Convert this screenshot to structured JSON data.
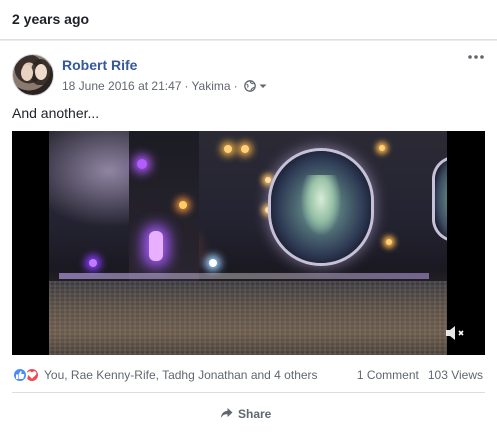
{
  "memory": {
    "title": "2 years ago"
  },
  "post": {
    "author": "Robert Rife",
    "date": "18 June 2016 at 21:47",
    "location": "Yakima",
    "separator": "·",
    "privacy_icon": "globe-icon",
    "menu_icon": "more-horizontal-icon",
    "text": "And another..."
  },
  "video": {
    "mute_icon": "volume-muted-icon"
  },
  "engagement": {
    "reaction_icons": [
      "like-icon",
      "love-icon"
    ],
    "reactions_text": "You, Rae Kenny-Rife, Tadhg Jonathan and 4 others",
    "comments": "1 Comment",
    "views": "103 Views"
  },
  "actions": {
    "share_label": "Share",
    "share_icon": "share-arrow-icon"
  },
  "colors": {
    "link": "#365899",
    "secondary_text": "#606770",
    "like_blue": "#4a8cf7",
    "love_red": "#f0484f",
    "background": "#e9ebee"
  }
}
